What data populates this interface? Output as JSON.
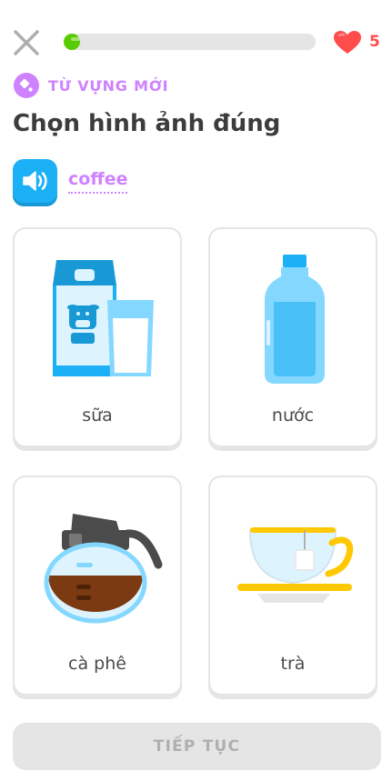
{
  "header": {
    "progress_percent": 5,
    "hearts_count": "5"
  },
  "badge": {
    "label": "TỪ VỰNG MỚI"
  },
  "prompt": {
    "title": "Chọn hình ảnh đúng",
    "word": "coffee"
  },
  "options": [
    {
      "label": "sữa",
      "icon": "milk-carton-icon"
    },
    {
      "label": "nước",
      "icon": "water-bottle-icon"
    },
    {
      "label": "cà phê",
      "icon": "coffee-pot-icon"
    },
    {
      "label": "trà",
      "icon": "tea-cup-icon"
    }
  ],
  "footer": {
    "continue_label": "TIẾP TỤC"
  },
  "colors": {
    "accent_purple": "#ce82ff",
    "progress_green": "#58cc02",
    "heart_red": "#ff4b4b",
    "speaker_blue": "#1cb0f6",
    "disabled_gray": "#e5e5e5"
  }
}
